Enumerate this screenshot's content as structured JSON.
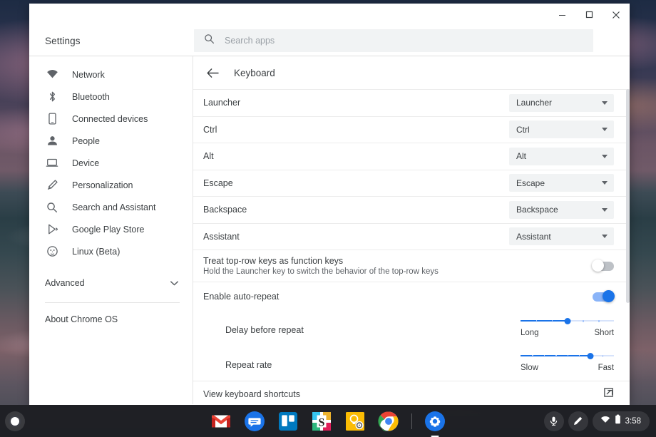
{
  "window": {
    "app_title": "Settings",
    "controls": {
      "minimize": "minimize-window",
      "maximize": "maximize-window",
      "close": "close-window"
    }
  },
  "search": {
    "icon": "search-icon",
    "placeholder": "Search apps",
    "value": ""
  },
  "sidebar": {
    "items": [
      {
        "label": "Network",
        "icon": "wifi-icon"
      },
      {
        "label": "Bluetooth",
        "icon": "bluetooth-icon"
      },
      {
        "label": "Connected devices",
        "icon": "phone-icon"
      },
      {
        "label": "People",
        "icon": "person-icon"
      },
      {
        "label": "Device",
        "icon": "laptop-icon"
      },
      {
        "label": "Personalization",
        "icon": "brush-icon"
      },
      {
        "label": "Search and Assistant",
        "icon": "search-icon"
      },
      {
        "label": "Google Play Store",
        "icon": "play-store-icon"
      },
      {
        "label": "Linux (Beta)",
        "icon": "penguin-icon"
      }
    ],
    "advanced": {
      "label": "Advanced",
      "icon": "chevron-down-icon"
    },
    "about": {
      "label": "About Chrome OS"
    }
  },
  "page": {
    "back_icon": "back-arrow-icon",
    "title": "Keyboard",
    "key_remap_rows": [
      {
        "label": "Launcher",
        "value": "Launcher"
      },
      {
        "label": "Ctrl",
        "value": "Ctrl"
      },
      {
        "label": "Alt",
        "value": "Alt"
      },
      {
        "label": "Escape",
        "value": "Escape"
      },
      {
        "label": "Backspace",
        "value": "Backspace"
      },
      {
        "label": "Assistant",
        "value": "Assistant"
      }
    ],
    "function_keys": {
      "label": "Treat top-row keys as function keys",
      "sublabel": "Hold the Launcher key to switch the behavior of the top-row keys",
      "state": "off"
    },
    "auto_repeat": {
      "label": "Enable auto-repeat",
      "state": "on"
    },
    "delay_slider": {
      "label": "Delay before repeat",
      "min_label": "Long",
      "max_label": "Short",
      "percent": 50
    },
    "rate_slider": {
      "label": "Repeat rate",
      "min_label": "Slow",
      "max_label": "Fast",
      "percent": 75
    },
    "shortcuts_link": {
      "label": "View keyboard shortcuts",
      "icon": "external-link-icon"
    }
  },
  "shelf": {
    "launcher": "launcher-button",
    "apps": [
      {
        "name": "Gmail",
        "icon": "gmail-icon"
      },
      {
        "name": "Messages",
        "icon": "messages-icon"
      },
      {
        "name": "Trello",
        "icon": "trello-icon"
      },
      {
        "name": "Slack",
        "icon": "slack-icon"
      },
      {
        "name": "Google Keep",
        "icon": "keep-icon"
      },
      {
        "name": "Google Chrome",
        "icon": "chrome-icon"
      },
      {
        "name": "Settings",
        "icon": "settings-gear-icon"
      }
    ],
    "tray": {
      "mic": "microphone-icon",
      "stylus": "stylus-pen-icon",
      "wifi": "wifi-icon",
      "battery": "battery-icon",
      "clock": "3:58"
    }
  },
  "colors": {
    "accent_blue": "#1a73e8",
    "toggle_on_track": "#8ab4f8",
    "toggle_off_track": "#bdc1c6",
    "text_primary": "#3c4043",
    "text_secondary": "#5f6368",
    "field_bg": "#f1f3f4"
  }
}
